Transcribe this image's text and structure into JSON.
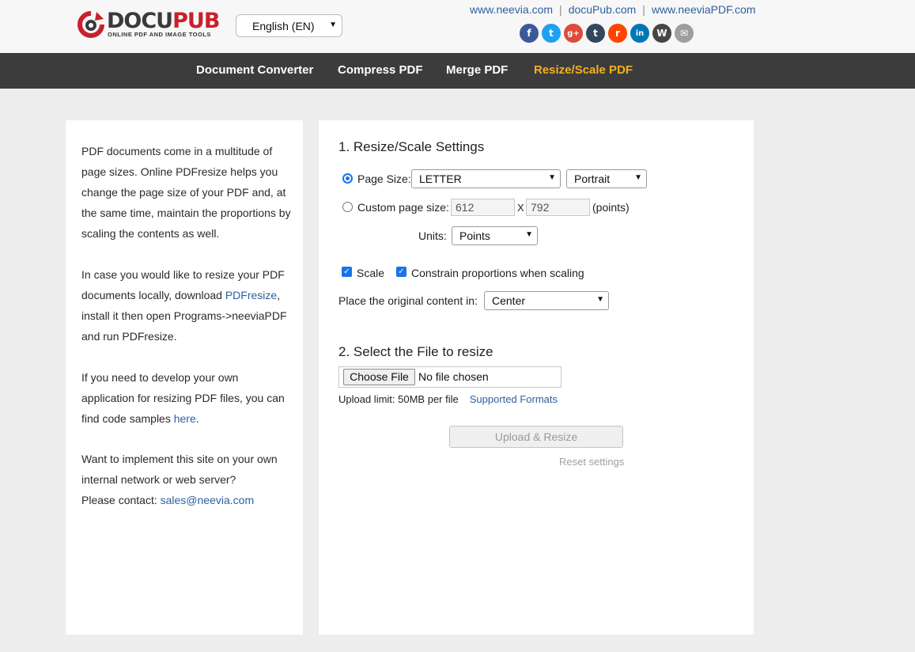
{
  "brand": {
    "name_part1": "DOCU",
    "name_part2": "PUB",
    "tagline": "ONLINE PDF AND IMAGE TOOLS",
    "colors": {
      "primary_dark": "#3a3a3a",
      "primary_red": "#c8202d",
      "nav_bg": "#3c3c3c",
      "nav_active": "#f5b11e",
      "link": "#2d5fa0"
    }
  },
  "language_select": {
    "value": "English (EN)"
  },
  "top_links": [
    "www.neevia.com",
    "docuPub.com",
    "www.neeviaPDF.com"
  ],
  "social_icons": [
    {
      "name": "facebook-icon",
      "glyph": "f",
      "color": "#3b5998"
    },
    {
      "name": "twitter-icon",
      "glyph": "t",
      "color": "#1da1f2"
    },
    {
      "name": "google-plus-icon",
      "glyph": "g+",
      "color": "#dd4b39"
    },
    {
      "name": "tumblr-icon",
      "glyph": "t",
      "color": "#35465c"
    },
    {
      "name": "reddit-icon",
      "glyph": "r",
      "color": "#ff4500"
    },
    {
      "name": "linkedin-icon",
      "glyph": "in",
      "color": "#0077b5"
    },
    {
      "name": "wordpress-icon",
      "glyph": "W",
      "color": "#464646"
    },
    {
      "name": "email-icon",
      "glyph": "✉",
      "color": "#9e9e9e"
    }
  ],
  "nav": {
    "items": [
      "Document Converter",
      "Compress PDF",
      "Merge PDF",
      "Resize/Scale PDF"
    ],
    "active": "Resize/Scale PDF"
  },
  "left_panel": {
    "p1": "PDF documents come in a multitude of page sizes. Online PDFresize helps you change the page size of your PDF and, at the same time, maintain the proportions by scaling the contents as well.",
    "p2_before": "In case you would like to resize your PDF documents locally, download ",
    "p2_link": "PDFresize",
    "p2_after": ", install it then open Programs->neeviaPDF and run PDFresize.",
    "p3_before": "If you need to develop your own application for resizing PDF files, you can find code samples ",
    "p3_link": "here",
    "p3_after": ".",
    "p4_line1": "Want to implement this site on your own internal network or web server?",
    "p4_line2": "Please contact: ",
    "p4_link": "sales@neevia.com"
  },
  "settings": {
    "title": "1. Resize/Scale Settings",
    "page_size_label": "Page Size:",
    "page_size_value": "LETTER",
    "orientation_value": "Portrait",
    "custom_size_label": "Custom page size:",
    "custom_width": "612",
    "custom_x": "X",
    "custom_height": "792",
    "custom_unit": "(points)",
    "units_label": "Units:",
    "units_value": "Points",
    "scale_label": "Scale",
    "constrain_label": "Constrain proportions when scaling",
    "place_label": "Place the original content in:",
    "place_value": "Center"
  },
  "file_section": {
    "title": "2. Select the File to resize",
    "choose_button": "Choose File",
    "status": "No file chosen",
    "limit_text": "Upload limit: 50MB per file",
    "formats_link": "Supported Formats",
    "upload_button": "Upload & Resize",
    "reset_link": "Reset settings"
  }
}
